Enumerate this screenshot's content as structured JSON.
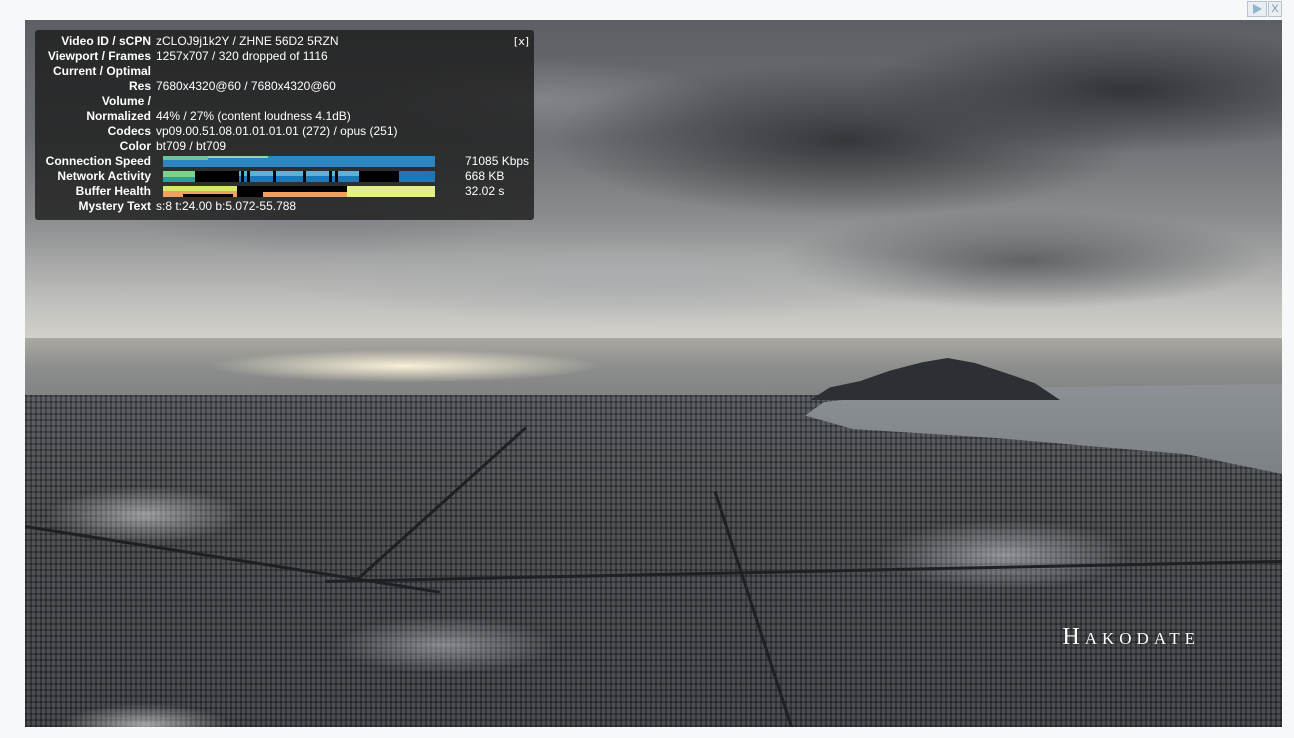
{
  "ad_controls": {
    "play_icon": "play-icon",
    "close_label": "X"
  },
  "video": {
    "watermark": "Hakodate"
  },
  "stats": {
    "close_label": "[x]",
    "rows": [
      {
        "label": "Video ID / sCPN",
        "value": "zCLOJ9j1k2Y / ZHNE 56D2 5RZN"
      },
      {
        "label": "Viewport / Frames",
        "value": "1257x707 / 320 dropped of 1116"
      },
      {
        "label": "Current / Optimal",
        "value": ""
      },
      {
        "label": "Res",
        "value": "7680x4320@60 / 7680x4320@60"
      },
      {
        "label": "Volume /",
        "value": ""
      },
      {
        "label": "Normalized",
        "value": "44% / 27% (content loudness 4.1dB)"
      },
      {
        "label": "Codecs",
        "value": "vp09.00.51.08.01.01.01.01 (272) / opus (251)"
      },
      {
        "label": "Color",
        "value": "bt709 / bt709"
      },
      {
        "label": "Mystery Text",
        "value": "s:8 t:24.00 b:5.072-55.788"
      }
    ],
    "graphs": [
      {
        "label": "Connection Speed",
        "value": "71085 Kbps",
        "color": "#2e86c1"
      },
      {
        "label": "Network Activity",
        "value": "668 KB",
        "color": "#1f77b4"
      },
      {
        "label": "Buffer Health",
        "value": "32.02 s",
        "color": "#d4e86a"
      }
    ]
  }
}
